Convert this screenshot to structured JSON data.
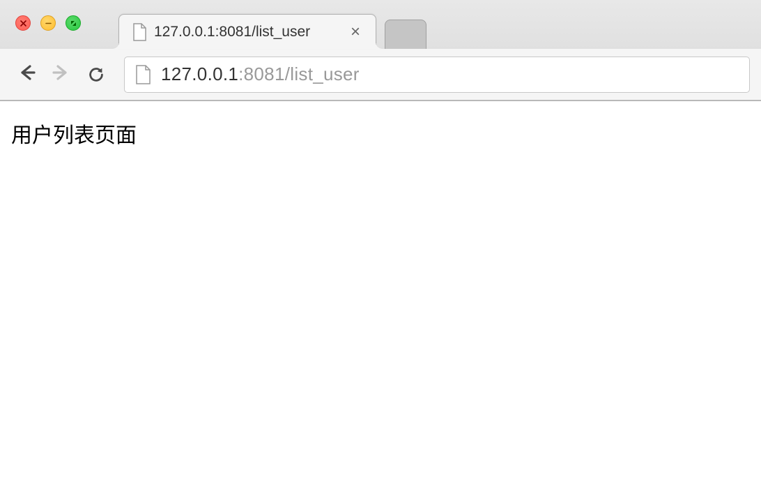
{
  "window": {
    "traffic_lights": {
      "close": "close",
      "minimize": "minimize",
      "maximize": "maximize"
    }
  },
  "tabs": [
    {
      "title": "127.0.0.1:8081/list_user",
      "active": true
    }
  ],
  "address": {
    "host": "127.0.0.1",
    "port": ":8081",
    "path": "/list_user"
  },
  "page": {
    "heading": "用户列表页面"
  }
}
